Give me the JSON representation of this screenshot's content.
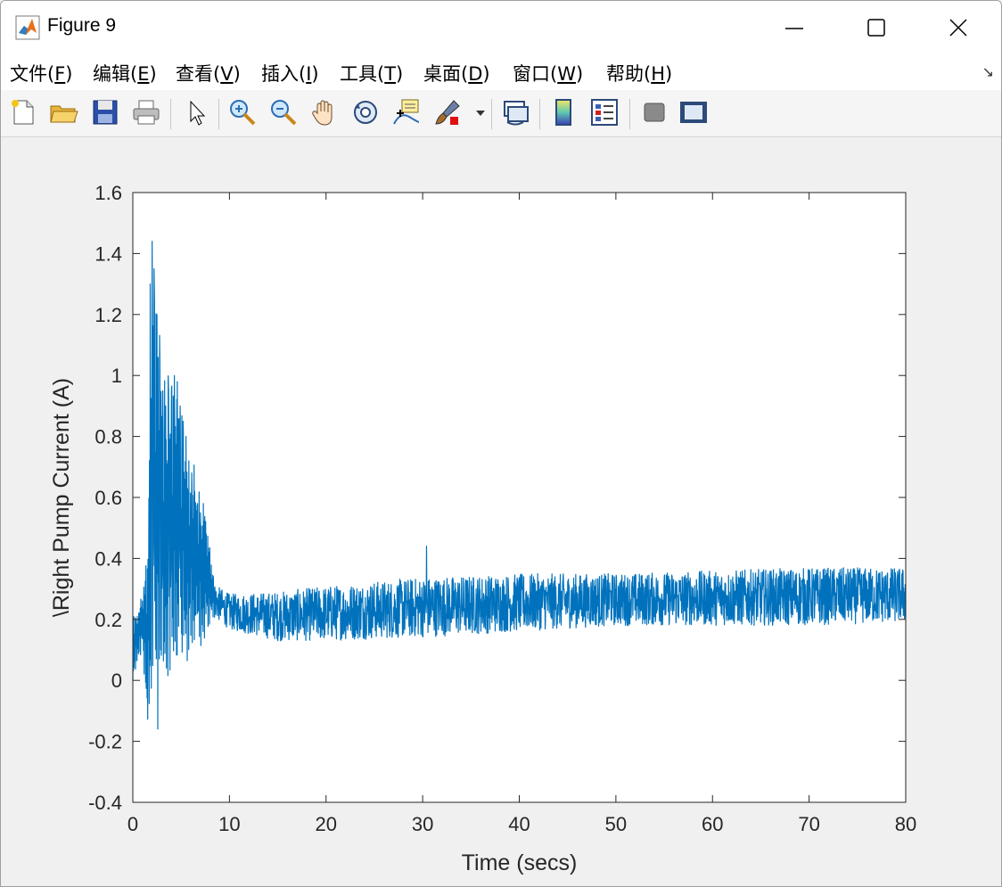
{
  "window": {
    "title": "Figure 9"
  },
  "menu": [
    {
      "label": "文件(",
      "key": "F",
      "suffix": ")"
    },
    {
      "label": "编辑(",
      "key": "E",
      "suffix": ")"
    },
    {
      "label": "查看(",
      "key": "V",
      "suffix": ")"
    },
    {
      "label": "插入(",
      "key": "I",
      "suffix": ")"
    },
    {
      "label": "工具(",
      "key": "T",
      "suffix": ")"
    },
    {
      "label": "桌面(",
      "key": "D",
      "suffix": ")"
    },
    {
      "label": "窗口(",
      "key": "W",
      "suffix": ")"
    },
    {
      "label": "帮助(",
      "key": "H",
      "suffix": ")"
    }
  ],
  "toolbar_icons": [
    "new-figure-icon",
    "open-file-icon",
    "save-icon",
    "print-icon",
    "pointer-icon",
    "zoom-in-icon",
    "zoom-out-icon",
    "pan-hand-icon",
    "rotate-3d-icon",
    "data-cursor-icon",
    "brush-icon",
    "link-plot-icon",
    "colorbar-icon",
    "legend-icon",
    "hide-plot-tools-icon",
    "show-plot-tools-icon"
  ],
  "colors": {
    "line": "#0072bd",
    "axes_bg": "#ffffff",
    "figure_bg": "#f0f0f0"
  },
  "chart_data": {
    "type": "line",
    "title": "",
    "xlabel": "Time (secs)",
    "ylabel": "\\Right Pump Current (A)",
    "xlim": [
      0,
      80
    ],
    "ylim": [
      -0.4,
      1.6
    ],
    "xticks": [
      "0",
      "10",
      "20",
      "30",
      "40",
      "50",
      "60",
      "70",
      "80"
    ],
    "yticks": [
      "-0.4",
      "-0.2",
      "0",
      "0.2",
      "0.4",
      "0.6",
      "0.8",
      "1",
      "1.2",
      "1.4",
      "1.6"
    ],
    "grid": false,
    "series": [
      {
        "name": "",
        "color": "#0072bd",
        "x": [
          0,
          0.3,
          0.6,
          0.9,
          1.2,
          1.5,
          1.8,
          2.0,
          2.2,
          2.5,
          2.8,
          3.1,
          3.4,
          3.7,
          4.0,
          4.3,
          4.6,
          4.9,
          5.2,
          5.5,
          5.8,
          6.1,
          6.4,
          6.7,
          7.0,
          7.3,
          7.6,
          7.9,
          8.2,
          8.5,
          9,
          10,
          12,
          14,
          16,
          18,
          20,
          22,
          24,
          26,
          28,
          30,
          30.4,
          32,
          34,
          36,
          38,
          40,
          42,
          44,
          46,
          48,
          50,
          52,
          54,
          56,
          58,
          60,
          62,
          64,
          66,
          68,
          70,
          72,
          74,
          76,
          78,
          80
        ],
        "y": [
          0.0,
          0.2,
          0.2,
          0.2,
          0.25,
          0.3,
          1.3,
          1.44,
          1.35,
          1.2,
          1.05,
          0.95,
          0.9,
          0.95,
          0.95,
          1.0,
          0.98,
          0.9,
          0.85,
          0.8,
          0.72,
          0.68,
          0.62,
          0.58,
          0.55,
          0.58,
          0.48,
          0.42,
          0.3,
          0.27,
          0.26,
          0.24,
          0.2,
          0.2,
          0.2,
          0.21,
          0.21,
          0.22,
          0.22,
          0.22,
          0.23,
          0.23,
          0.44,
          0.23,
          0.23,
          0.24,
          0.24,
          0.25,
          0.25,
          0.26,
          0.26,
          0.26,
          0.27,
          0.27,
          0.27,
          0.27,
          0.27,
          0.27,
          0.27,
          0.27,
          0.27,
          0.27,
          0.27,
          0.27,
          0.27,
          0.27,
          0.27,
          0.27
        ]
      }
    ],
    "envelope": {
      "x": [
        0,
        1,
        1.5,
        2,
        2.5,
        3,
        3.5,
        4,
        4.5,
        5,
        5.5,
        6,
        6.5,
        7,
        7.5,
        8,
        8.5,
        10,
        15,
        20,
        30,
        40,
        50,
        60,
        70,
        80
      ],
      "upper": [
        0.2,
        0.3,
        0.5,
        1.44,
        1.3,
        1.1,
        1.0,
        1.0,
        1.05,
        0.95,
        0.85,
        0.75,
        0.7,
        0.6,
        0.62,
        0.45,
        0.32,
        0.29,
        0.3,
        0.32,
        0.35,
        0.36,
        0.36,
        0.37,
        0.38,
        0.38
      ],
      "lower": [
        0.0,
        0.1,
        -0.2,
        -0.26,
        -0.2,
        -0.15,
        -0.1,
        -0.08,
        -0.05,
        0.0,
        0.02,
        0.05,
        0.08,
        0.1,
        0.12,
        0.18,
        0.2,
        0.16,
        0.12,
        0.12,
        0.13,
        0.15,
        0.17,
        0.17,
        0.17,
        0.18
      ]
    }
  }
}
